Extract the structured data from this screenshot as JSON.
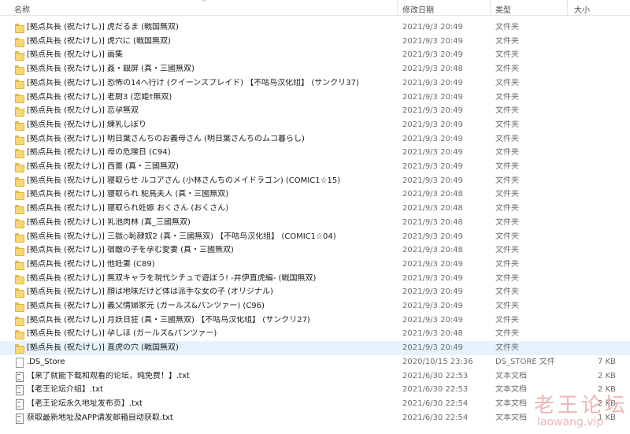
{
  "header": {
    "name": "名称",
    "date": "修改日期",
    "type": "类型",
    "size": "大小"
  },
  "rows": [
    {
      "icon": "folder-icon",
      "name": "[拠点兵長 (祝たけし)] 虎だるま (戦国無双)",
      "date": "2021/9/3 20:49",
      "type": "文件夹",
      "size": ""
    },
    {
      "icon": "folder-icon",
      "name": "[拠点兵長 (祝たけし)] 虎穴に (戦国無双)",
      "date": "2021/9/3 20:49",
      "type": "文件夹",
      "size": ""
    },
    {
      "icon": "folder-icon",
      "name": "[拠点兵長 (祝たけし)] 画集",
      "date": "2021/9/3 20:49",
      "type": "文件夹",
      "size": ""
    },
    {
      "icon": "folder-icon",
      "name": "[拠点兵長 (祝たけし)] 姦・銀屏 (真・三國無双)",
      "date": "2021/9/3 20:48",
      "type": "文件夹",
      "size": ""
    },
    {
      "icon": "folder-icon",
      "name": "[拠点兵長 (祝たけし)] 恐怖の14へ行け (クイーンズブレイド) 【不咕鸟汉化组】 (サンクリ37)",
      "date": "2021/9/3 20:49",
      "type": "文件夹",
      "size": ""
    },
    {
      "icon": "folder-icon",
      "name": "[拠点兵長 (祝たけし)] 老厨3 (恋姫†無双)",
      "date": "2021/9/3 20:49",
      "type": "文件夹",
      "size": ""
    },
    {
      "icon": "folder-icon",
      "name": "[拠点兵長 (祝たけし)] 恋孕無双",
      "date": "2021/9/3 20:49",
      "type": "文件夹",
      "size": ""
    },
    {
      "icon": "folder-icon",
      "name": "[拠点兵長 (祝たけし)] 練乳しぼり",
      "date": "2021/9/3 20:49",
      "type": "文件夹",
      "size": ""
    },
    {
      "icon": "folder-icon",
      "name": "[拠点兵長 (祝たけし)] 明日葉さんちのお義母さん (明日葉さんちのムコ暮らし)",
      "date": "2021/9/3 20:49",
      "type": "文件夹",
      "size": ""
    },
    {
      "icon": "folder-icon",
      "name": "[拠点兵長 (祝たけし)] 母の危険日 (C94)",
      "date": "2021/9/3 20:49",
      "type": "文件夹",
      "size": ""
    },
    {
      "icon": "folder-icon",
      "name": "[拠点兵長 (祝たけし)] 西蕾 (真・三國無双)",
      "date": "2021/9/3 20:49",
      "type": "文件夹",
      "size": ""
    },
    {
      "icon": "folder-icon",
      "name": "[拠点兵長 (祝たけし)] 寝取らせ ルコアさん (小林さんちのメイドラゴン) (COMIC1☆15)",
      "date": "2021/9/3 20:49",
      "type": "文件夹",
      "size": ""
    },
    {
      "icon": "folder-icon",
      "name": "[拠点兵長 (祝たけし)] 寝取られ 駝鳥夫人 (真・三國無双)",
      "date": "2021/9/3 20:48",
      "type": "文件夹",
      "size": ""
    },
    {
      "icon": "folder-icon",
      "name": "[拠点兵長 (祝たけし)] 寝取られ妊娠 おくさん (おくさん)",
      "date": "2021/9/3 20:48",
      "type": "文件夹",
      "size": ""
    },
    {
      "icon": "folder-icon",
      "name": "[拠点兵長 (祝たけし)] 乳池肉林 (真_三國無双)",
      "date": "2021/9/3 20:48",
      "type": "文件夹",
      "size": ""
    },
    {
      "icon": "folder-icon",
      "name": "[拠点兵長 (祝たけし)] 三獄◇恥隷奴2 (真・三國無双) 【不咕鸟汉化组】 (COMIC1☆04)",
      "date": "2021/9/3 20:49",
      "type": "文件夹",
      "size": ""
    },
    {
      "icon": "folder-icon",
      "name": "[拠点兵長 (祝たけし)] 宿敵の子を孕む愛妻 (真・三國無双)",
      "date": "2021/9/3 20:48",
      "type": "文件夹",
      "size": ""
    },
    {
      "icon": "folder-icon",
      "name": "[拠点兵長 (祝たけし)] 他妊妻 (C89)",
      "date": "2021/9/3 20:49",
      "type": "文件夹",
      "size": ""
    },
    {
      "icon": "folder-icon",
      "name": "[拠点兵長 (祝たけし)] 無双キャラを現代シチュで遊ぼう! -井伊直虎編- (戦国無双)",
      "date": "2021/9/3 20:49",
      "type": "文件夹",
      "size": ""
    },
    {
      "icon": "folder-icon",
      "name": "[拠点兵長 (祝たけし)] 顔は地味だけど体は派手な女の子 (オリジナル)",
      "date": "2021/9/3 20:49",
      "type": "文件夹",
      "size": ""
    },
    {
      "icon": "folder-icon",
      "name": "[拠点兵長 (祝たけし)] 義父情婦家元 (ガールズ&パンツァー) (C96)",
      "date": "2021/9/3 20:49",
      "type": "文件夹",
      "size": ""
    },
    {
      "icon": "folder-icon",
      "name": "[拠点兵長 (祝たけし)] 月妖日狂 (真・三國無双) 【不咕鸟汉化组】 (サンクリ27)",
      "date": "2021/9/3 20:49",
      "type": "文件夹",
      "size": ""
    },
    {
      "icon": "folder-icon",
      "name": "[拠点兵長 (祝たけし)] 孕しほ (ガールズ&パンツァー)",
      "date": "2021/9/3 20:48",
      "type": "文件夹",
      "size": ""
    },
    {
      "icon": "folder-icon",
      "name": "[拠点兵長 (祝たけし)] 直虎の穴 (戦国無双)",
      "date": "2021/9/3 20:49",
      "type": "文件夹",
      "size": "",
      "selected": true
    },
    {
      "icon": "file-icon",
      "name": ".DS_Store",
      "date": "2020/10/15 23:36",
      "type": "DS_STORE 文件",
      "size": "7 KB"
    },
    {
      "icon": "txt-icon",
      "name": "【来了就能下载和观看的论坛，纯免费！】.txt",
      "date": "2021/6/30 22:53",
      "type": "文本文档",
      "size": "2 KB"
    },
    {
      "icon": "txt-icon",
      "name": "【老王论坛介绍】.txt",
      "date": "2021/6/30 22:53",
      "type": "文本文档",
      "size": "2 KB"
    },
    {
      "icon": "txt-icon",
      "name": "【老王论坛永久地址发布页】.txt",
      "date": "2021/6/30 22:54",
      "type": "文本文档",
      "size": "2 KB"
    },
    {
      "icon": "txt-icon",
      "name": "获取最新地址及APP请发邮箱自动获取.txt",
      "date": "2021/6/30 22:54",
      "type": "文本文档",
      "size": "1 KB"
    }
  ],
  "watermark": {
    "title": "老王论坛",
    "url": "laowang.vip"
  }
}
